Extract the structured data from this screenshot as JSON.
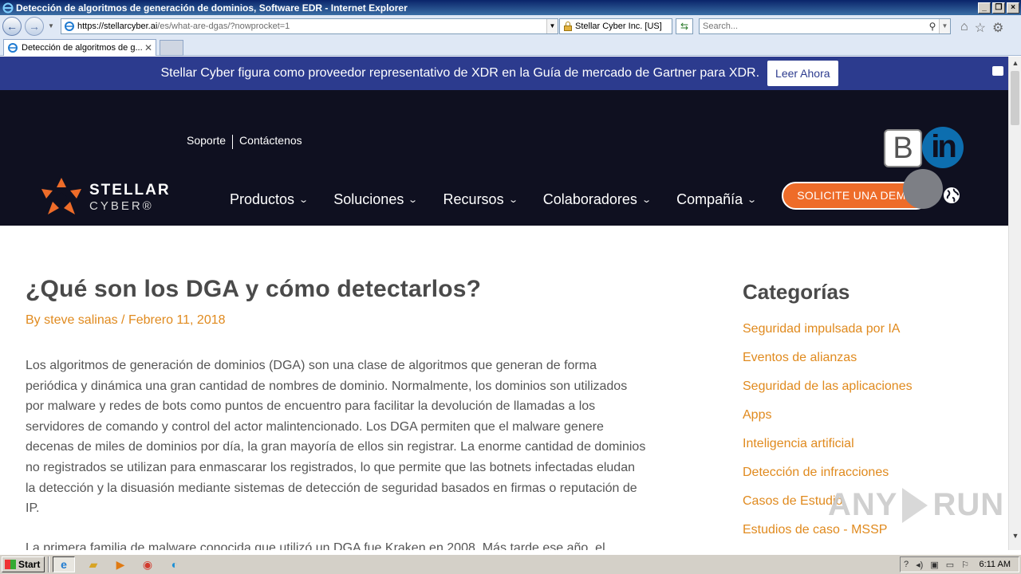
{
  "window": {
    "title": "Detección de algoritmos de generación de dominios, Software EDR - Internet Explorer",
    "min": "_",
    "max": "❐",
    "close": "×"
  },
  "addressbar": {
    "url_host": "https://stellarcyber.ai",
    "url_path": "/es/what-are-dgas/?nowprocket=1",
    "cert": "Stellar Cyber Inc. [US]",
    "search_placeholder": "Search..."
  },
  "tab": {
    "label": "Detección de algoritmos de g..."
  },
  "announcement": {
    "text": "Stellar Cyber figura como proveedor representativo de XDR en la Guía de mercado de Gartner para XDR.",
    "button": "Leer Ahora"
  },
  "header": {
    "toplinks": [
      "Soporte",
      "Contáctenos"
    ],
    "logo_line1": "STELLAR",
    "logo_line2": "CYBER®",
    "nav": [
      "Productos",
      "Soluciones",
      "Recursos",
      "Colaboradores",
      "Compañía"
    ],
    "demo_button": "SOLICITE UNA DEMO",
    "social_b": "B",
    "social_in": "in"
  },
  "article": {
    "title": "¿Qué son los DGA y cómo detectarlos?",
    "meta": "By steve salinas / Febrero 11, 2018",
    "p1": "Los algoritmos de generación de dominios (DGA) son una clase de algoritmos que generan de forma periódica y dinámica una gran cantidad de nombres de dominio. Normalmente, los dominios son utilizados por malware y redes de bots como puntos de encuentro para facilitar la devolución de llamadas a los servidores de comando y control del actor malintencionado. Los DGA permiten que el malware genere decenas de miles de dominios por día, la gran mayoría de ellos sin registrar. La enorme cantidad de dominios no registrados se utilizan para enmascarar los registrados, lo que permite que las botnets infectadas eludan la detección y la disuasión mediante sistemas de detección de seguridad basados en firmas o reputación de IP.",
    "p2": "La primera familia de malware conocida que utilizó un DGA fue Kraken en 2008. Más tarde ese año, el"
  },
  "sidebar": {
    "heading": "Categorías",
    "items": [
      "Seguridad impulsada por IA",
      "Eventos de alianzas",
      "Seguridad de las aplicaciones",
      "Apps",
      "Inteligencia artificial",
      "Detección de infracciones",
      "Casos de Estudio",
      "Estudios de caso - MSSP"
    ]
  },
  "watermark": {
    "left": "ANY",
    "right": "RUN"
  },
  "taskbar": {
    "start": "Start",
    "clock": "6:11 AM"
  },
  "colors": {
    "accent_orange": "#ee6c29",
    "link_orange": "#e08a1e",
    "announce_blue": "#2c3b8e",
    "header_dark": "#0f1020"
  }
}
